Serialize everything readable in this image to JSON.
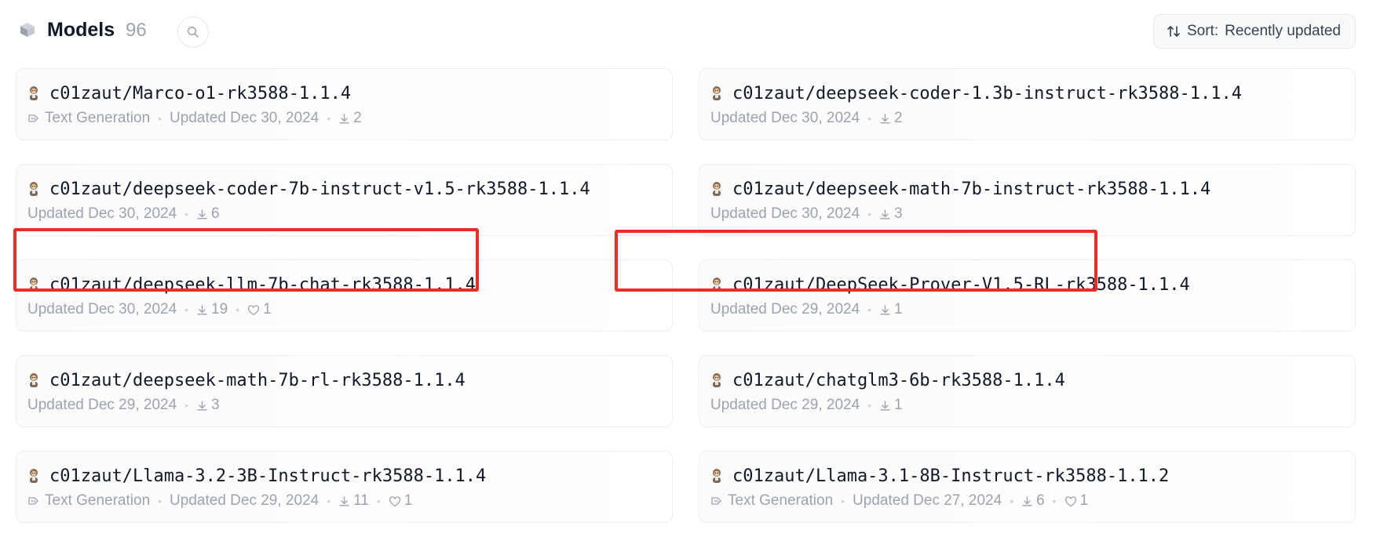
{
  "header": {
    "title": "Models",
    "count": "96",
    "sort_label": "Sort:",
    "sort_value": "Recently updated"
  },
  "models": [
    {
      "name": "c01zaut/Marco-o1-rk3588-1.1.4",
      "task": "Text Generation",
      "updated": "Updated Dec 30, 2024",
      "downloads": "2",
      "likes": ""
    },
    {
      "name": "c01zaut/deepseek-coder-1.3b-instruct-rk3588-1.1.4",
      "task": "",
      "updated": "Updated Dec 30, 2024",
      "downloads": "2",
      "likes": ""
    },
    {
      "name": "c01zaut/deepseek-coder-7b-instruct-v1.5-rk3588-1.1.4",
      "task": "",
      "updated": "Updated Dec 30, 2024",
      "downloads": "6",
      "likes": ""
    },
    {
      "name": "c01zaut/deepseek-math-7b-instruct-rk3588-1.1.4",
      "task": "",
      "updated": "Updated Dec 30, 2024",
      "downloads": "3",
      "likes": ""
    },
    {
      "name": "c01zaut/deepseek-llm-7b-chat-rk3588-1.1.4",
      "task": "",
      "updated": "Updated Dec 30, 2024",
      "downloads": "19",
      "likes": "1"
    },
    {
      "name": "c01zaut/DeepSeek-Prover-V1.5-RL-rk3588-1.1.4",
      "task": "",
      "updated": "Updated Dec 29, 2024",
      "downloads": "1",
      "likes": ""
    },
    {
      "name": "c01zaut/deepseek-math-7b-rl-rk3588-1.1.4",
      "task": "",
      "updated": "Updated Dec 29, 2024",
      "downloads": "3",
      "likes": ""
    },
    {
      "name": "c01zaut/chatglm3-6b-rk3588-1.1.4",
      "task": "",
      "updated": "Updated Dec 29, 2024",
      "downloads": "1",
      "likes": ""
    },
    {
      "name": "c01zaut/Llama-3.2-3B-Instruct-rk3588-1.1.4",
      "task": "Text Generation",
      "updated": "Updated Dec 29, 2024",
      "downloads": "11",
      "likes": "1"
    },
    {
      "name": "c01zaut/Llama-3.1-8B-Instruct-rk3588-1.1.2",
      "task": "Text Generation",
      "updated": "Updated Dec 27, 2024",
      "downloads": "6",
      "likes": "1"
    }
  ],
  "colors": {
    "highlight": "#ef2b23",
    "muted_text": "#9ca3af",
    "card_border": "#eceef1"
  },
  "icons": {
    "section": "cube-icon",
    "search": "search-icon",
    "sort": "sort-arrows-icon",
    "avatar": "user-avatar-icon",
    "task": "text-generation-icon",
    "downloads": "download-icon",
    "likes": "heart-icon"
  }
}
